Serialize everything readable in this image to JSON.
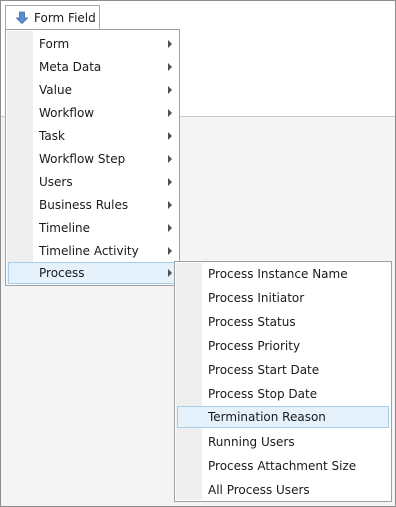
{
  "toolbar": {
    "form_field_label": "Form Field"
  },
  "menu": {
    "items": [
      {
        "label": "Form"
      },
      {
        "label": "Meta Data"
      },
      {
        "label": "Value"
      },
      {
        "label": "Workflow"
      },
      {
        "label": "Task"
      },
      {
        "label": "Workflow Step"
      },
      {
        "label": "Users"
      },
      {
        "label": "Business Rules"
      },
      {
        "label": "Timeline"
      },
      {
        "label": "Timeline Activity"
      },
      {
        "label": "Process"
      }
    ],
    "highlighted": "Process"
  },
  "submenu": {
    "items": [
      {
        "label": "Process Instance Name"
      },
      {
        "label": "Process Initiator"
      },
      {
        "label": "Process Status"
      },
      {
        "label": "Process Priority"
      },
      {
        "label": "Process Start Date"
      },
      {
        "label": "Process Stop Date"
      },
      {
        "label": "Termination Reason"
      },
      {
        "label": "Running Users"
      },
      {
        "label": "Process Attachment Size"
      },
      {
        "label": "All Process Users"
      }
    ],
    "highlighted": "Termination Reason"
  },
  "colors": {
    "highlight_bg": "#e5f1fb",
    "highlight_border": "#a8cde9",
    "arrow_icon": "#5b8fd0"
  }
}
